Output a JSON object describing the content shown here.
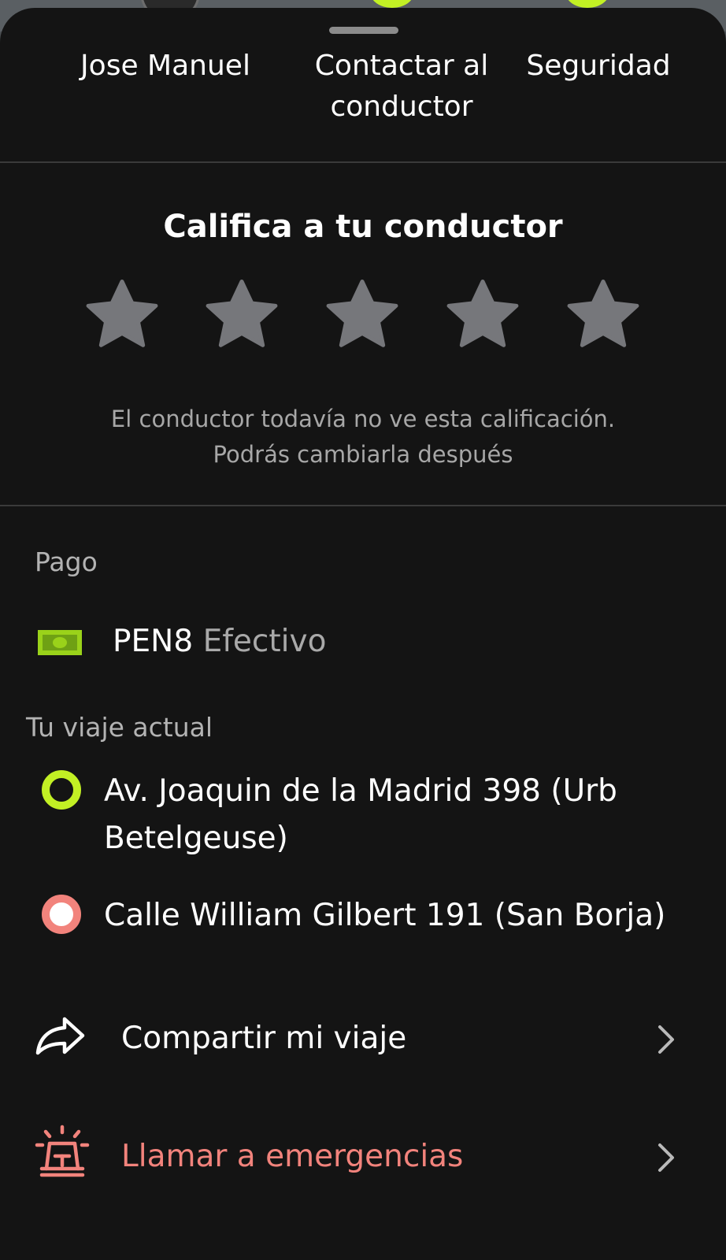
{
  "colors": {
    "sheet_bg": "#141414",
    "accent_green": "#c2f024",
    "accent_red": "#f2837c",
    "star_gray": "#76777b",
    "muted_text": "#a7a7a7"
  },
  "top_actions": [
    {
      "label": "Jose Manuel"
    },
    {
      "label": "Contactar al conductor"
    },
    {
      "label": "Seguridad"
    }
  ],
  "rating": {
    "title": "Califica a tu conductor",
    "stars_total": 5,
    "stars_selected": 0,
    "note_line1": "El conductor todavía no ve esta calificación.",
    "note_line2": "Podrás cambiarla después"
  },
  "payment": {
    "section_label": "Pago",
    "amount": "PEN8",
    "method": "Efectivo",
    "icon": "cash-icon"
  },
  "trip": {
    "section_label": "Tu viaje actual",
    "pickup_line1": "Av. Joaquin de la Madrid 398 (Urb",
    "pickup_line2": "Betelgeuse)",
    "destination": "Calle William Gilbert 191 (San Borja)"
  },
  "actions": {
    "share_label": "Compartir mi viaje",
    "share_icon": "share-arrow-icon",
    "emergency_label": "Llamar a emergencias",
    "emergency_icon": "siren-icon"
  }
}
